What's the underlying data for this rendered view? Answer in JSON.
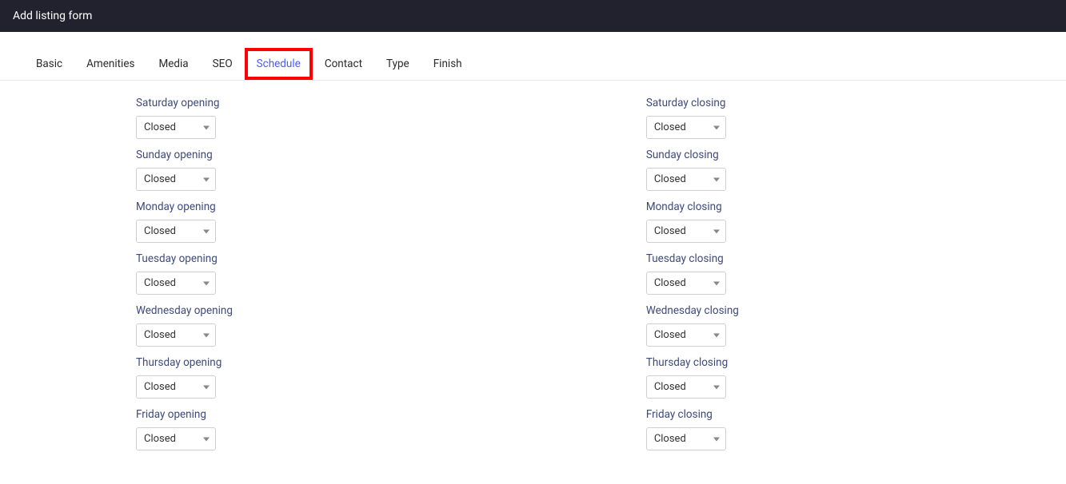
{
  "header": {
    "title": "Add listing form"
  },
  "tabs": [
    {
      "label": "Basic",
      "active": false,
      "highlighted": false
    },
    {
      "label": "Amenities",
      "active": false,
      "highlighted": false
    },
    {
      "label": "Media",
      "active": false,
      "highlighted": false
    },
    {
      "label": "SEO",
      "active": false,
      "highlighted": false
    },
    {
      "label": "Schedule",
      "active": true,
      "highlighted": true
    },
    {
      "label": "Contact",
      "active": false,
      "highlighted": false
    },
    {
      "label": "Type",
      "active": false,
      "highlighted": false
    },
    {
      "label": "Finish",
      "active": false,
      "highlighted": false
    }
  ],
  "schedule": {
    "opening": [
      {
        "label": "Saturday opening",
        "value": "Closed"
      },
      {
        "label": "Sunday opening",
        "value": "Closed"
      },
      {
        "label": "Monday opening",
        "value": "Closed"
      },
      {
        "label": "Tuesday opening",
        "value": "Closed"
      },
      {
        "label": "Wednesday opening",
        "value": "Closed"
      },
      {
        "label": "Thursday opening",
        "value": "Closed"
      },
      {
        "label": "Friday opening",
        "value": "Closed"
      }
    ],
    "closing": [
      {
        "label": "Saturday closing",
        "value": "Closed"
      },
      {
        "label": "Sunday closing",
        "value": "Closed"
      },
      {
        "label": "Monday closing",
        "value": "Closed"
      },
      {
        "label": "Tuesday closing",
        "value": "Closed"
      },
      {
        "label": "Wednesday closing",
        "value": "Closed"
      },
      {
        "label": "Thursday closing",
        "value": "Closed"
      },
      {
        "label": "Friday closing",
        "value": "Closed"
      }
    ]
  }
}
